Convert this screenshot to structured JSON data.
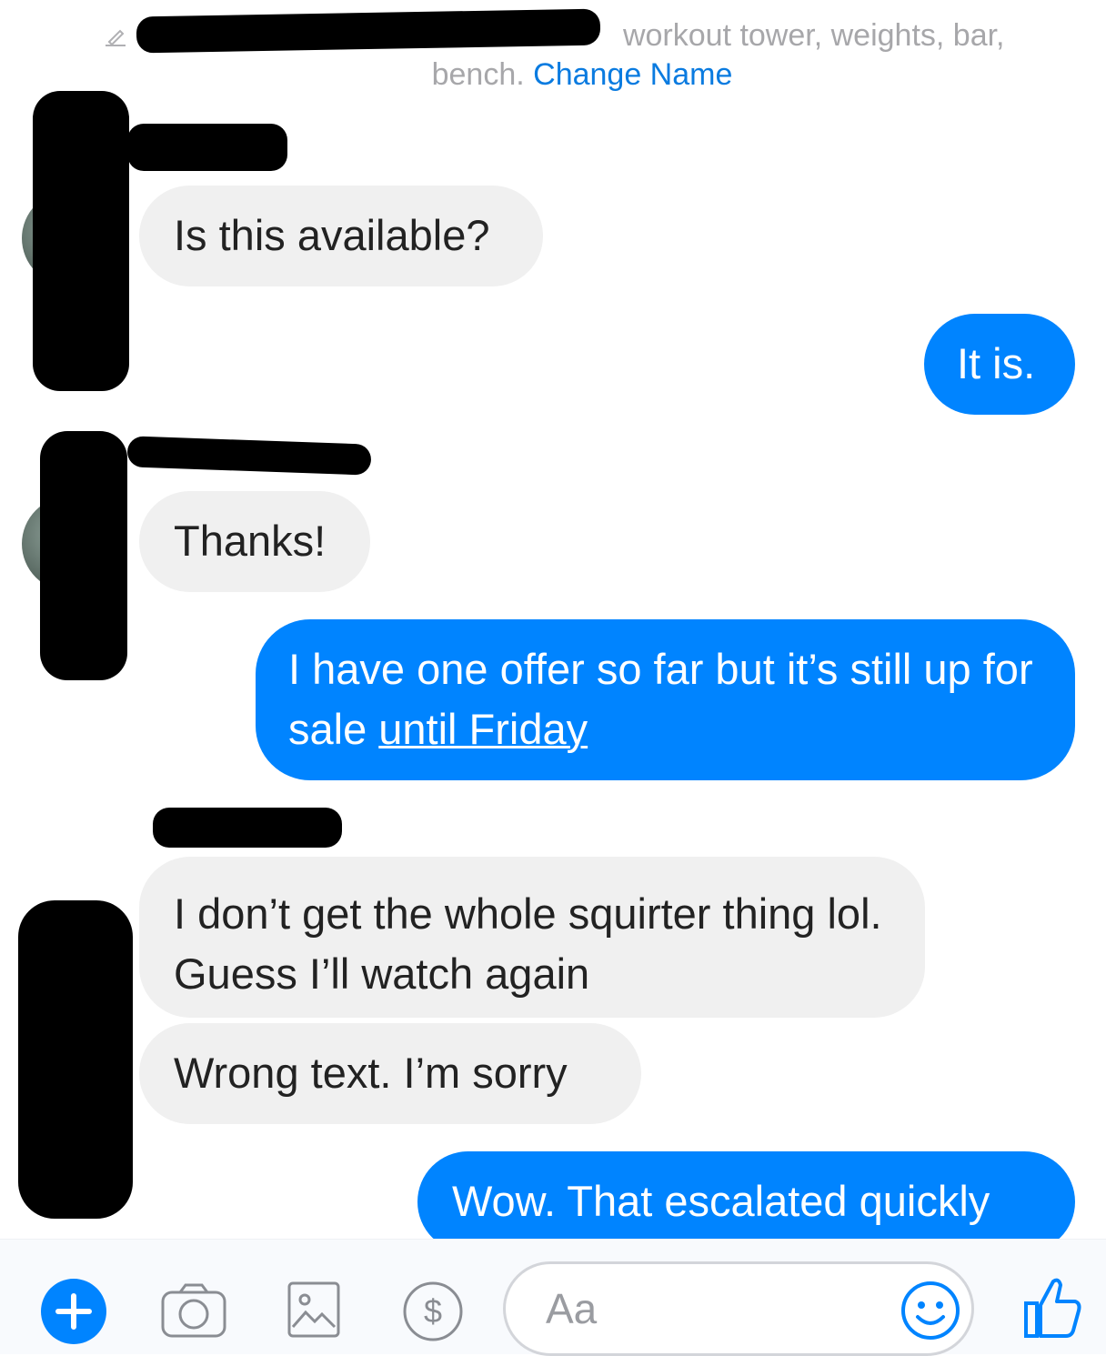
{
  "header": {
    "note_text": "workout tower, weights, bar,",
    "note_text_2": "bench.",
    "change_name_label": "Change Name"
  },
  "messages": [
    {
      "from": "them",
      "text": "Is this available?"
    },
    {
      "from": "me",
      "text": "It is."
    },
    {
      "from": "them",
      "text": "Thanks!"
    },
    {
      "from": "me",
      "text_before_link": "I have one offer so far but it’s still up for sale ",
      "link_text": "until Friday"
    },
    {
      "from": "them",
      "text": "I don’t get the whole squirter thing lol. Guess I’ll watch again"
    },
    {
      "from": "them",
      "text": "Wrong text. I’m sorry"
    },
    {
      "from": "me",
      "text": "Wow. That escalated quickly"
    }
  ],
  "composer": {
    "placeholder": "Aa",
    "icons": [
      "plus-icon",
      "camera-icon",
      "gallery-icon",
      "dollar-icon",
      "emoji-icon",
      "thumbs-up-icon"
    ]
  },
  "colors": {
    "accent": "#0084ff",
    "incoming_bubble": "#f0f0f0",
    "link": "#0a7be0"
  }
}
